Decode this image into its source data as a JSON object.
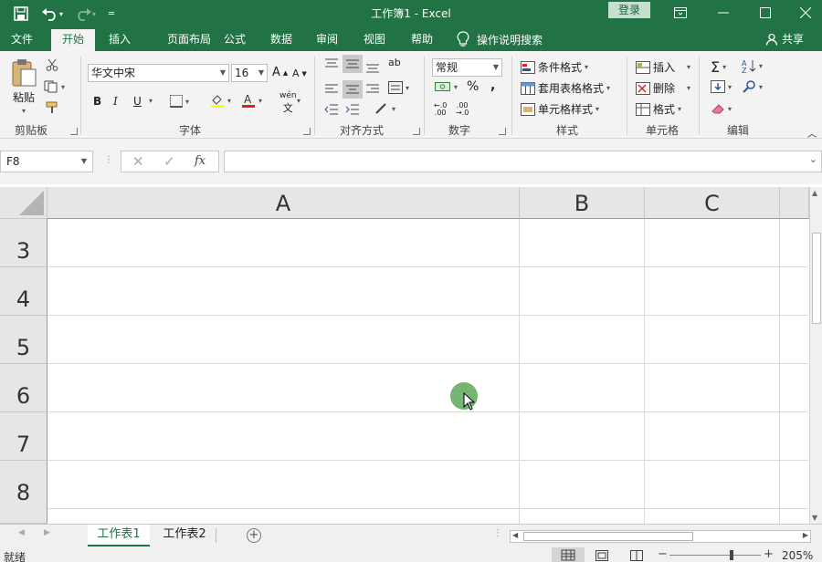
{
  "window": {
    "title": "工作簿1  -  Excel",
    "login_label": "登录"
  },
  "tabs": [
    {
      "label": "文件"
    },
    {
      "label": "开始"
    },
    {
      "label": "插入"
    },
    {
      "label": "页面布局"
    },
    {
      "label": "公式"
    },
    {
      "label": "数据"
    },
    {
      "label": "审阅"
    },
    {
      "label": "视图"
    },
    {
      "label": "帮助"
    }
  ],
  "tell_me_label": "操作说明搜索",
  "share_label": "共享",
  "ribbon": {
    "clipboard": {
      "paste_label": "粘贴",
      "group_label": "剪贴板"
    },
    "font": {
      "font_name": "华文中宋",
      "font_size": "16",
      "group_label": "字体",
      "bold": "B",
      "italic": "I",
      "underline": "U",
      "phonetic": "wén"
    },
    "alignment": {
      "group_label": "对齐方式"
    },
    "number": {
      "format": "常规",
      "percent": "%",
      "comma": ",",
      "group_label": "数字"
    },
    "styles": {
      "conditional_format": "条件格式",
      "table_format": "套用表格格式",
      "cell_styles": "单元格样式",
      "group_label": "样式"
    },
    "cells": {
      "insert": "插入",
      "delete": "删除",
      "format": "格式",
      "group_label": "单元格"
    },
    "editing": {
      "group_label": "编辑"
    }
  },
  "formula_bar": {
    "name_box": "F8",
    "value": ""
  },
  "grid": {
    "columns": [
      "A",
      "B",
      "C"
    ],
    "rows": [
      "3",
      "4",
      "5",
      "6",
      "7",
      "8"
    ]
  },
  "sheets": [
    {
      "label": "工作表1"
    },
    {
      "label": "工作表2"
    }
  ],
  "status": {
    "ready": "就绪",
    "zoom": "205%"
  },
  "colors": {
    "brand": "#217346",
    "click_indicator": "#5da85b"
  }
}
